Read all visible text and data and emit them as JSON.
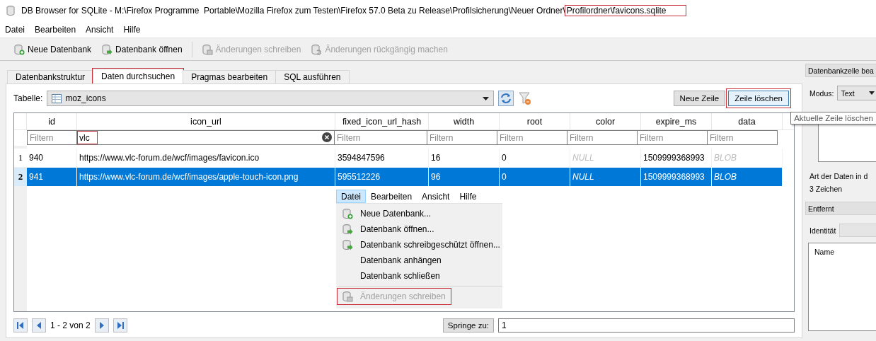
{
  "window": {
    "title_parts": [
      {
        "text": "DB Browser for SQLite - M:\\Firefox Programme  Portable\\Mozilla Firefox zum Testen\\Firefox 57.0 Beta zu Release\\Profilsicherung\\Neuer Ordner\\",
        "highlighted": false
      },
      {
        "text": "Profilordner\\favicons.sqlite",
        "highlighted": true
      }
    ]
  },
  "menu": [
    "Datei",
    "Bearbeiten",
    "Ansicht",
    "Hilfe"
  ],
  "toolbar": [
    {
      "label": "Neue Datenbank",
      "kind": "new",
      "disabled": false
    },
    {
      "label": "Datenbank öffnen",
      "kind": "open",
      "disabled": false
    },
    {
      "label": "Änderungen schreiben",
      "kind": "save",
      "disabled": true
    },
    {
      "label": "Änderungen rückgängig machen",
      "kind": "revert",
      "disabled": true
    }
  ],
  "tabs": [
    {
      "label": "Datenbankstruktur",
      "selected": false,
      "highlighted": false
    },
    {
      "label": "Daten durchsuchen",
      "selected": true,
      "highlighted": true
    },
    {
      "label": "Pragmas bearbeiten",
      "selected": false,
      "highlighted": false
    },
    {
      "label": "SQL ausführen",
      "selected": false,
      "highlighted": false
    }
  ],
  "table_picker": {
    "label": "Tabelle:",
    "value": "moz_icons"
  },
  "row_buttons": [
    {
      "label": "Neue Zeile",
      "highlighted": false
    },
    {
      "label": "Zeile löschen",
      "highlighted": true
    }
  ],
  "tooltip": "Aktuelle Zeile löschen",
  "table": {
    "columns": [
      "id",
      "icon_url",
      "fixed_icon_url_hash",
      "width",
      "root",
      "color",
      "expire_ms",
      "data"
    ],
    "filters": [
      {
        "placeholder": "Filtern"
      },
      {
        "value": "vlc",
        "highlighted": true
      },
      {
        "placeholder": "Filtern"
      },
      {
        "placeholder": "Filtern"
      },
      {
        "placeholder": "Filtern"
      },
      {
        "placeholder": "Filtern"
      },
      {
        "placeholder": "Filtern"
      },
      {
        "placeholder": "Filtern"
      }
    ],
    "rows": [
      {
        "number": "1",
        "selected": false,
        "cells": [
          {
            "text": "940",
            "kind": "value"
          },
          {
            "text": "https://www.vlc-forum.de/wcf/images/favicon.ico",
            "kind": "value"
          },
          {
            "text": "3594847596",
            "kind": "value"
          },
          {
            "text": "16",
            "kind": "value"
          },
          {
            "text": "0",
            "kind": "value"
          },
          {
            "text": "NULL",
            "kind": "null"
          },
          {
            "text": "1509999368993",
            "kind": "value"
          },
          {
            "text": "BLOB",
            "kind": "null"
          }
        ]
      },
      {
        "number": "2",
        "selected": true,
        "cells": [
          {
            "text": "941",
            "kind": "value"
          },
          {
            "text": "https://www.vlc-forum.de/wcf/images/apple-touch-icon.png",
            "kind": "value"
          },
          {
            "text": "595512226",
            "kind": "value"
          },
          {
            "text": "96",
            "kind": "value"
          },
          {
            "text": "0",
            "kind": "value"
          },
          {
            "text": "NULL",
            "kind": "null"
          },
          {
            "text": "1509999368993",
            "kind": "value"
          },
          {
            "text": "BLOB",
            "kind": "null"
          }
        ]
      }
    ]
  },
  "menu_screenshot": {
    "menubar": [
      {
        "label": "Datei",
        "selected": true
      },
      {
        "label": "Bearbeiten",
        "selected": false
      },
      {
        "label": "Ansicht",
        "selected": false
      },
      {
        "label": "Hilfe",
        "selected": false
      }
    ],
    "items": [
      {
        "kind": "new",
        "label": "Neue Datenbank...",
        "disabled": false,
        "highlighted": false
      },
      {
        "kind": "open",
        "label": "Datenbank öffnen...",
        "disabled": false,
        "highlighted": false
      },
      {
        "kind": "open",
        "label": "Datenbank schreibgeschützt öffnen...",
        "disabled": false,
        "highlighted": false
      },
      {
        "kind": "plain",
        "label": "Datenbank anhängen",
        "disabled": false,
        "highlighted": false
      },
      {
        "kind": "plain",
        "label": "Datenbank schließen",
        "disabled": false,
        "highlighted": false
      },
      {
        "kind": "separator"
      },
      {
        "kind": "save",
        "label": "Änderungen schreiben",
        "disabled": true,
        "highlighted": true
      }
    ]
  },
  "pager": {
    "range": "1 - 2 von 2",
    "goto_label": "Springe zu:",
    "goto_value": "1"
  },
  "dock": {
    "title": "Datenbankzelle bea",
    "mode_label": "Modus:",
    "mode_value": "Text",
    "type_label": "Art der Daten in d",
    "size_text": "3 Zeichen",
    "remote_title": "Entfernt",
    "identity_label": "Identität",
    "list_header": "Name"
  }
}
